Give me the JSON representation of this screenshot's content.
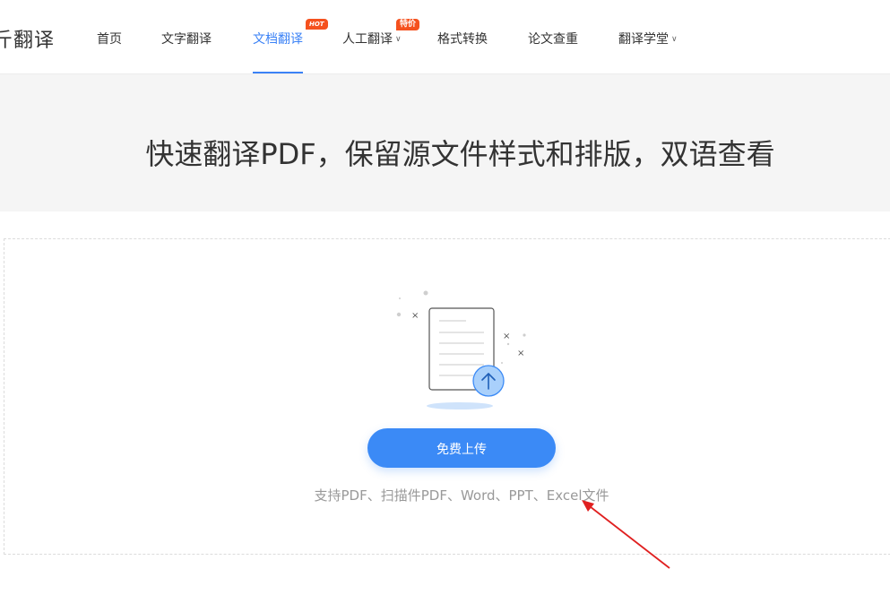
{
  "header": {
    "brand": "斤翻译",
    "nav": [
      {
        "label": "首页"
      },
      {
        "label": "文字翻译"
      },
      {
        "label": "文档翻译",
        "badge": "HOT",
        "active": true
      },
      {
        "label": "人工翻译",
        "badge": "特价",
        "dropdown": true
      },
      {
        "label": "格式转换"
      },
      {
        "label": "论文查重"
      },
      {
        "label": "翻译学堂",
        "dropdown": true
      }
    ]
  },
  "hero": {
    "title": "快速翻译PDF，保留源文件样式和排版，双语查看"
  },
  "upload": {
    "button_label": "免费上传",
    "support_text": "支持PDF、扫描件PDF、Word、PPT、Excel文件"
  },
  "colors": {
    "accent": "#3b82f6",
    "button": "#3b8af6",
    "badge": "#f5511e",
    "annotation": "#e02020"
  },
  "icons": {
    "upload_illustration": "document-upload-icon",
    "dropdown": "chevron-down-icon",
    "annotation": "red-arrow"
  }
}
